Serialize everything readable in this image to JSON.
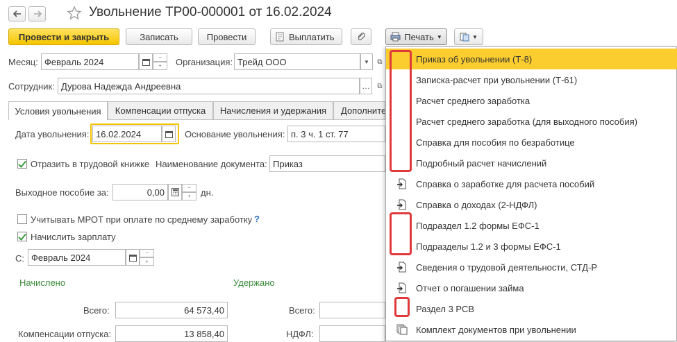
{
  "doc_title": "Увольнение ТР00-000001 от 16.02.2024",
  "toolbar": {
    "post_close": "Провести и закрыть",
    "save": "Записать",
    "post": "Провести",
    "pay": "Выплатить",
    "print": "Печать"
  },
  "header": {
    "month_label": "Месяц:",
    "month_value": "Февраль 2024",
    "org_label": "Организация:",
    "org_value": "Трейд ООО",
    "employee_label": "Сотрудник:",
    "employee_value": "Дурова Надежда Андреевна"
  },
  "tabs": [
    "Условия увольнения",
    "Компенсации отпуска",
    "Начисления и удержания",
    "Дополните"
  ],
  "form": {
    "dismissal_date_label": "Дата увольнения:",
    "dismissal_date": "16.02.2024",
    "reason_label": "Основание увольнения:",
    "reason_value": "п. 3 ч. 1 ст. 77",
    "workbook_label": "Отразить в трудовой книжке",
    "doc_name_label": "Наименование документа:",
    "doc_name_value": "Приказ",
    "severance_label": "Выходное пособие за:",
    "severance_value": "0,00",
    "severance_unit": "дн.",
    "mrot_label": "Учитывать МРОТ при оплате по среднему заработку",
    "mrot_help": "?",
    "accrue_salary_label": "Начислить зарплату",
    "from_label": "С:",
    "from_value": "Февраль 2024",
    "accrued_header": "Начислено",
    "withheld_header": "Удержано",
    "total_label": "Всего:",
    "total_value": "64 573,40",
    "comp_label": "Компенсации отпуска:",
    "comp_value": "13 858,40",
    "withheld_total_label": "Всего:",
    "ndfl_label": "НДФЛ:"
  },
  "print_menu": [
    {
      "label": "Приказ об увольнении (Т-8)",
      "icon": "none",
      "selected": true
    },
    {
      "label": "Записка-расчет при увольнении (Т-61)",
      "icon": "none"
    },
    {
      "label": "Расчет среднего заработка",
      "icon": "none"
    },
    {
      "label": "Расчет среднего заработка (для выходного пособия)",
      "icon": "none"
    },
    {
      "label": "Справка для пособия по безработице",
      "icon": "none"
    },
    {
      "label": "Подробный расчет начислений",
      "icon": "none"
    },
    {
      "label": "Справка о заработке для расчета пособий",
      "icon": "document-arrow-icon"
    },
    {
      "label": "Справка о доходах (2-НДФЛ)",
      "icon": "document-arrow-icon"
    },
    {
      "label": "Подраздел 1.2 формы ЕФС-1",
      "icon": "none"
    },
    {
      "label": "Подразделы 1.2 и 3 формы ЕФС-1",
      "icon": "none"
    },
    {
      "label": "Сведения о трудовой деятельности, СТД-Р",
      "icon": "document-arrow-icon"
    },
    {
      "label": "Отчет о погашении займа",
      "icon": "document-arrow-icon"
    },
    {
      "label": "Раздел 3 РСВ",
      "icon": "none"
    },
    {
      "label": "Комплект документов при увольнении",
      "icon": "document-stack-icon"
    }
  ],
  "colors": {
    "accent": "#f5c400",
    "selected_item": "#fbcd2e",
    "highlight_red": "#e0393a",
    "green_text": "#3a8b3a"
  }
}
